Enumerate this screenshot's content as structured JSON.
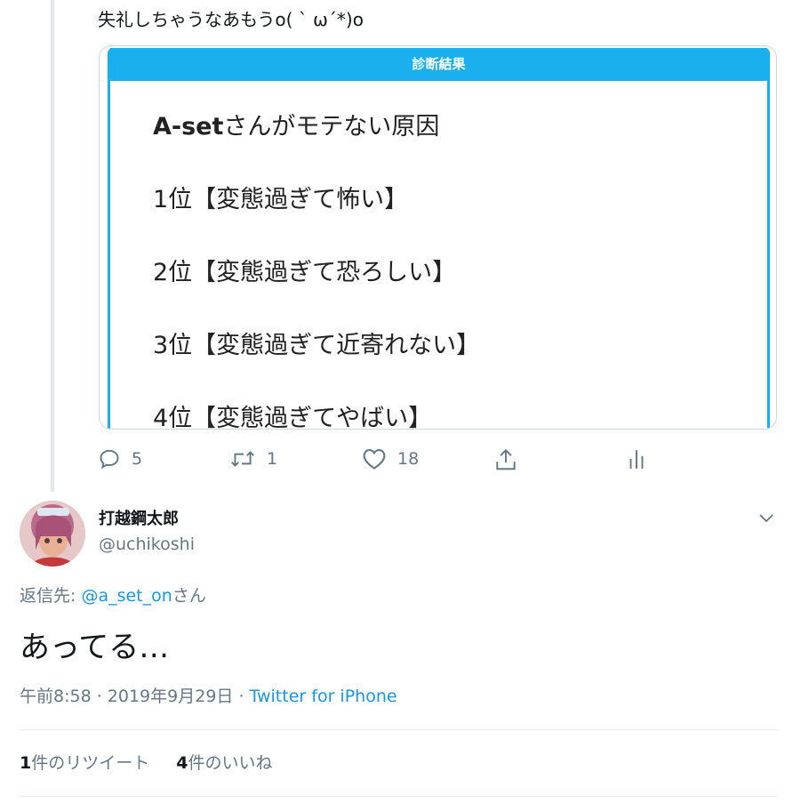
{
  "parent_tweet": {
    "text": "失礼しちゃうなあもうo( ` ω´*)o",
    "card": {
      "header": "診断結果",
      "name": "A-set",
      "title_suffix": "さんがモテない原因",
      "items": [
        "1位【変態過ぎて怖い】",
        "2位【変態過ぎて恐ろしい】",
        "3位【変態過ぎて近寄れない】",
        "4位【変態過ぎてやばい】"
      ]
    },
    "actions": {
      "reply_count": "5",
      "retweet_count": "1",
      "like_count": "18"
    }
  },
  "main_tweet": {
    "author_name": "打越鋼太郎",
    "author_handle": "@uchikoshi",
    "reply_prefix": "返信先: ",
    "reply_mention": "@a_set_on",
    "reply_suffix": "さん",
    "text": "あってる…",
    "time": "午前8:58 · 2019年9月29日 · ",
    "source": "Twitter for iPhone",
    "retweets": {
      "count": "1",
      "label": "件のリツイート"
    },
    "likes": {
      "count": "4",
      "label": "件のいいね"
    }
  },
  "colors": {
    "accent": "#1b95e0",
    "card_accent": "#1ab0f0",
    "muted": "#657786"
  }
}
